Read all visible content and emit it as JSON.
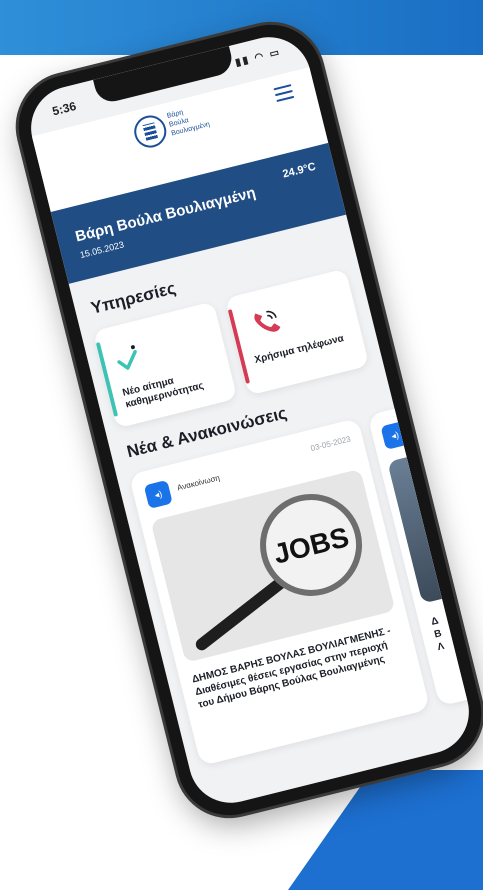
{
  "status": {
    "time": "5:36",
    "icons": "▮▮ ◠ ▭"
  },
  "header": {
    "logo_lines": [
      "Βάρη",
      "Βούλα",
      "Βουλιαγμένη"
    ],
    "logo_side": "Δήμος"
  },
  "banner": {
    "title": "Βάρη Βούλα Βουλιαγμένη",
    "date": "15.05.2023",
    "temperature": "24.9°C"
  },
  "services": {
    "title": "Υπηρεσίες",
    "items": [
      {
        "label": "Νέο αίτημα καθημερινότητας",
        "icon": "check-icon",
        "color": "#3cc3b4"
      },
      {
        "label": "Χρήσιμα τηλέφωνα",
        "icon": "phone-icon",
        "color": "#d63b55"
      }
    ]
  },
  "news": {
    "title": "Νέα & Ανακοινώσεις",
    "items": [
      {
        "category": "Ανακοίνωση",
        "date": "03-05-2023",
        "image_text": "JOBS",
        "title": "ΔΗΜΟΣ ΒΑΡΗΣ ΒΟΥΛΑΣ ΒΟΥΛΙΑΓΜΕΝΗΣ - Διαθέσιμες θέσεις εργασίας στην περιοχή του Δήμου Βάρης Βούλας Βουλιαγμένης"
      },
      {
        "title": "Δ\nΒ\nΛ"
      }
    ]
  },
  "colors": {
    "brand": "#1f4d84",
    "accent": "#1a73e8",
    "bg_band": "#1a6fc4"
  }
}
